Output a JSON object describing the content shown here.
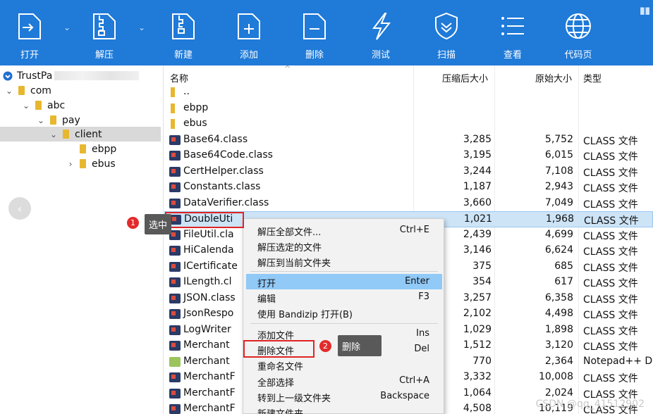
{
  "toolbar": {
    "buttons": [
      {
        "label": "打开",
        "icon": "open-icon"
      },
      {
        "label": "解压",
        "icon": "extract-icon"
      },
      {
        "label": "新建",
        "icon": "new-archive-icon"
      },
      {
        "label": "添加",
        "icon": "add-icon"
      },
      {
        "label": "删除",
        "icon": "delete-icon"
      },
      {
        "label": "测试",
        "icon": "test-icon"
      },
      {
        "label": "扫描",
        "icon": "scan-icon"
      },
      {
        "label": "查看",
        "icon": "view-icon"
      },
      {
        "label": "代码页",
        "icon": "codepage-icon"
      }
    ],
    "dropdown_glyph": "⌄"
  },
  "tree": {
    "root": "TrustPa",
    "items": [
      {
        "label": "com"
      },
      {
        "label": "abc"
      },
      {
        "label": "pay"
      },
      {
        "label": "client"
      },
      {
        "label": "ebpp"
      },
      {
        "label": "ebus"
      }
    ],
    "back_glyph": "‹"
  },
  "list": {
    "columns": {
      "name": "名称",
      "packed": "压缩后大小",
      "original": "原始大小",
      "type": "类型"
    },
    "rows": [
      {
        "name": "..",
        "packed": "",
        "original": "",
        "type": ""
      },
      {
        "name": "ebpp",
        "packed": "",
        "original": "",
        "type": ""
      },
      {
        "name": "ebus",
        "packed": "",
        "original": "",
        "type": ""
      },
      {
        "name": "Base64.class",
        "packed": "3,285",
        "original": "5,752",
        "type": "CLASS 文件"
      },
      {
        "name": "Base64Code.class",
        "packed": "3,195",
        "original": "6,015",
        "type": "CLASS 文件"
      },
      {
        "name": "CertHelper.class",
        "packed": "3,244",
        "original": "7,108",
        "type": "CLASS 文件"
      },
      {
        "name": "Constants.class",
        "packed": "1,187",
        "original": "2,943",
        "type": "CLASS 文件"
      },
      {
        "name": "DataVerifier.class",
        "packed": "3,660",
        "original": "7,049",
        "type": "CLASS 文件"
      },
      {
        "name": "DoubleUti",
        "packed": "1,021",
        "original": "1,968",
        "type": "CLASS 文件"
      },
      {
        "name": "FileUtil.cla",
        "packed": "2,439",
        "original": "4,699",
        "type": "CLASS 文件"
      },
      {
        "name": "HiCalenda",
        "packed": "3,146",
        "original": "6,624",
        "type": "CLASS 文件"
      },
      {
        "name": "ICertificate",
        "packed": "375",
        "original": "685",
        "type": "CLASS 文件"
      },
      {
        "name": "ILength.cl",
        "packed": "354",
        "original": "617",
        "type": "CLASS 文件"
      },
      {
        "name": "JSON.class",
        "packed": "3,257",
        "original": "6,358",
        "type": "CLASS 文件"
      },
      {
        "name": "JsonRespo",
        "packed": "2,102",
        "original": "4,498",
        "type": "CLASS 文件"
      },
      {
        "name": "LogWriter",
        "packed": "1,029",
        "original": "1,898",
        "type": "CLASS 文件"
      },
      {
        "name": "Merchant",
        "packed": "1,512",
        "original": "3,120",
        "type": "CLASS 文件"
      },
      {
        "name": "Merchant",
        "packed": "770",
        "original": "2,364",
        "type": "Notepad++ Do"
      },
      {
        "name": "MerchantF",
        "packed": "3,332",
        "original": "10,008",
        "type": "CLASS 文件"
      },
      {
        "name": "MerchantF",
        "packed": "1,064",
        "original": "2,024",
        "type": "CLASS 文件"
      },
      {
        "name": "MerchantF",
        "packed": "4,508",
        "original": "10,119",
        "type": "CLASS 文件"
      }
    ]
  },
  "context_menu": {
    "items": [
      {
        "label": "解压全部文件...",
        "shortcut": "Ctrl+E"
      },
      {
        "label": "解压选定的文件",
        "shortcut": ""
      },
      {
        "label": "解压到当前文件夹",
        "shortcut": ""
      },
      {
        "label": "打开",
        "shortcut": "Enter"
      },
      {
        "label": "编辑",
        "shortcut": "F3"
      },
      {
        "label": "使用 Bandizip 打开(B)",
        "shortcut": ""
      },
      {
        "label": "添加文件",
        "shortcut": "Ins"
      },
      {
        "label": "删除文件",
        "shortcut": "Del"
      },
      {
        "label": "重命名文件",
        "shortcut": ""
      },
      {
        "label": "全部选择",
        "shortcut": "Ctrl+A"
      },
      {
        "label": "转到上一级文件夹",
        "shortcut": "Backspace"
      },
      {
        "label": "新建文件夹",
        "shortcut": ""
      }
    ]
  },
  "annotations": {
    "step1_number": "1",
    "step1_text": "选中",
    "step2_number": "2",
    "step2_text": "删除",
    "color": "#e32b2b"
  },
  "watermark": "CSDN @qq_41512902"
}
